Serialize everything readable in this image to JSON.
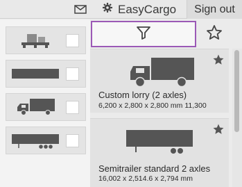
{
  "header": {
    "mail_icon": "envelope-icon",
    "brand_icon": "gear-icon",
    "brand_name": "EasyCargo",
    "signout_label": "Sign out"
  },
  "sidebar": {
    "items": [
      {
        "icon": "pallet-boxes-icon",
        "checked": false
      },
      {
        "icon": "flat-trailer-icon",
        "checked": false
      },
      {
        "icon": "lorry-icon",
        "checked": false
      },
      {
        "icon": "semitrailer-icon",
        "checked": false
      }
    ]
  },
  "toolbar": {
    "filter_icon": "filter-icon",
    "favorite_icon": "star-outline-icon"
  },
  "vehicles": [
    {
      "name": "Custom lorry (2 axles)",
      "dims": "6,200 x 2,800 x 2,800 mm 11,300",
      "favorite": true
    },
    {
      "name": "Semitrailer standard 2 axles",
      "dims": "16,002 x 2,514.6 x 2,794 mm",
      "favorite": true
    }
  ],
  "colors": {
    "accent": "#9b59b6",
    "icon_dark": "#555555"
  }
}
